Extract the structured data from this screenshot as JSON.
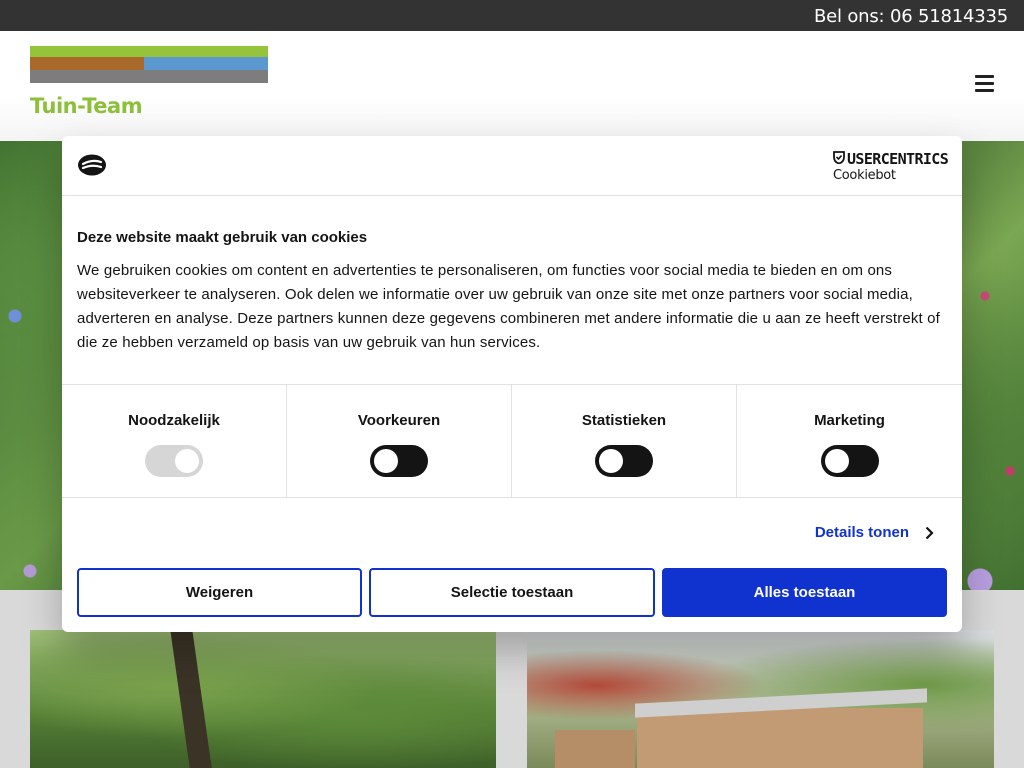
{
  "topbar": {
    "phone_text": "Bel ons: 06 51814335"
  },
  "header": {
    "logo_text": "Tuin-Team"
  },
  "cookie_banner": {
    "brand": "USERCENTRICS",
    "brand_sub": "Cookiebot",
    "title": "Deze website maakt gebruik van cookies",
    "text": "We gebruiken cookies om content en advertenties te personaliseren, om functies voor social media te bieden en om ons websiteverkeer te analyseren. Ook delen we informatie over uw gebruik van onze site met onze partners voor social media, adverteren en analyse. Deze partners kunnen deze gegevens combineren met andere informatie die u aan ze heeft verstrekt of die ze hebben verzameld op basis van uw gebruik van hun services.",
    "categories": [
      {
        "label": "Noodzakelijk",
        "enabled": true,
        "locked": true
      },
      {
        "label": "Voorkeuren",
        "enabled": false,
        "locked": false
      },
      {
        "label": "Statistieken",
        "enabled": false,
        "locked": false
      },
      {
        "label": "Marketing",
        "enabled": false,
        "locked": false
      }
    ],
    "details_label": "Details tonen",
    "buttons": {
      "deny": "Weigeren",
      "select": "Selectie toestaan",
      "allow_all": "Alles toestaan"
    }
  },
  "colors": {
    "accent_blue": "#1032cf",
    "logo_green": "#8dc03a",
    "logo_brown": "#a8692b",
    "logo_blue": "#5b98d0",
    "logo_grey": "#7d7d7d",
    "topbar_bg": "#333333"
  },
  "icons": {
    "menu": "hamburger-icon",
    "cookie": "cookie-icon",
    "details": "chevron-right-icon"
  }
}
